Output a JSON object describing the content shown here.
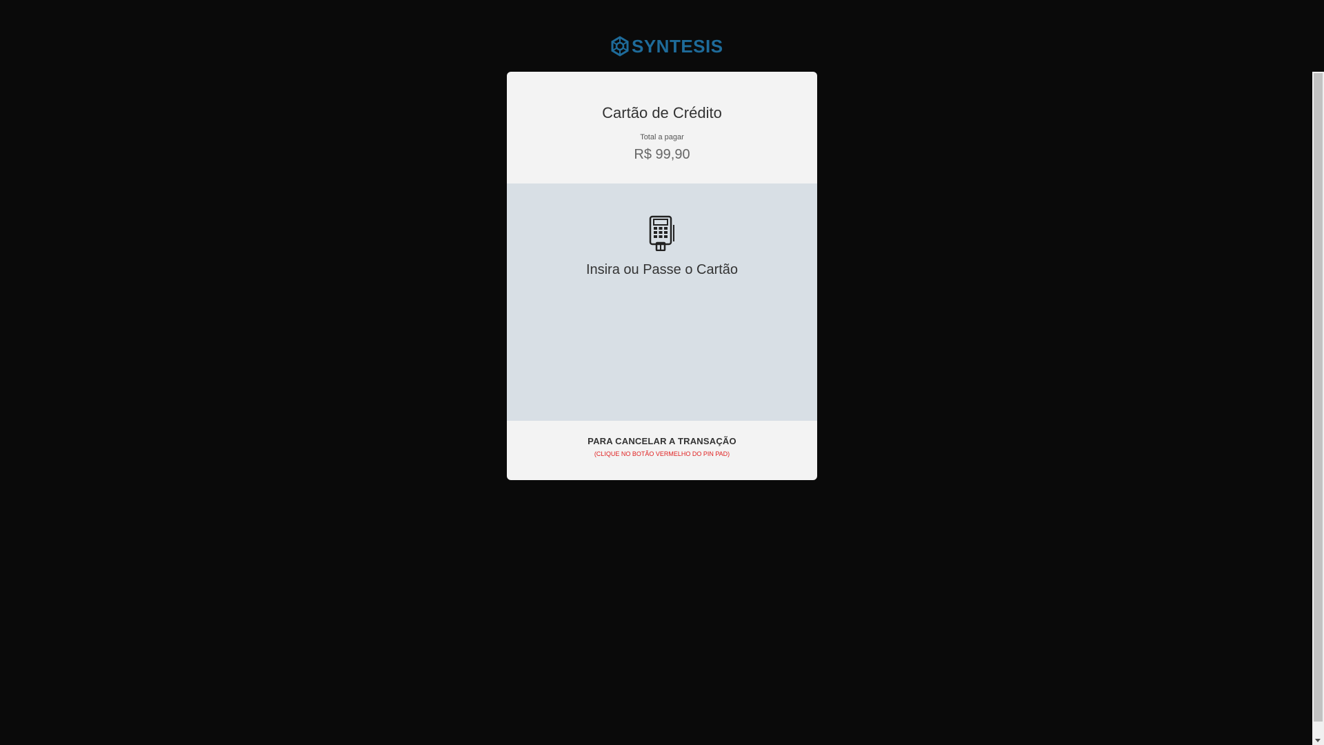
{
  "brand": {
    "name": "SYNTESIS",
    "logo_icon": "gear-hexagon-icon",
    "color": "#1e6b9a"
  },
  "payment": {
    "title": "Cartão de Crédito",
    "total_label": "Total a pagar",
    "total_value": "R$ 99,90"
  },
  "instruction": {
    "icon": "pinpad-terminal-icon",
    "text": "Insira ou Passe o Cartão"
  },
  "cancel": {
    "title": "PARA CANCELAR A TRANSAÇÃO",
    "hint": "(CLIQUE NO BOTÃO VERMELHO DO PIN PAD)",
    "hint_color": "#e02020"
  },
  "colors": {
    "background": "#0a0a0a",
    "card": "#f3f3f3",
    "card_body": "#d8dfe5"
  }
}
